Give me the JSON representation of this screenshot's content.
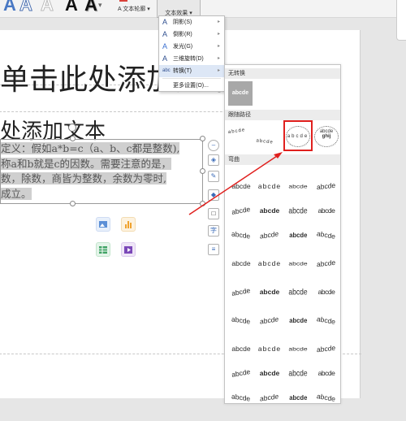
{
  "ribbon": {
    "art_letters": [
      "A",
      "A",
      "A",
      "A",
      "A"
    ],
    "art_dropdown_icon": "chevron-down-icon",
    "text_outline_label": "文本轮廓",
    "text_effects_label": "文本效果"
  },
  "slide": {
    "title": "单击此处添加文本",
    "subtitle": "处添加文本",
    "paragraph": [
      "定义：假如a*b=c（a、b、c都是整数),",
      "称a和b就是c的因数。需要注意的是，",
      "数，除数，商皆为整数，余数为零时,",
      "成立。"
    ]
  },
  "menu": {
    "items": [
      {
        "label": "阴影(S)",
        "icon": "shadow-icon"
      },
      {
        "label": "倒影(R)",
        "icon": "reflection-icon"
      },
      {
        "label": "发光(G)",
        "icon": "glow-icon"
      },
      {
        "label": "三维旋转(D)",
        "icon": "3d-rotate-icon"
      },
      {
        "label": "转换(T)",
        "icon": "transform-icon",
        "highlighted": true
      },
      {
        "label": "更多设置(O)..."
      }
    ]
  },
  "panel": {
    "no_transform_header": "无转换",
    "no_transform_sample": "abcde",
    "follow_path_header": "跟随路径",
    "warp_header": "弯曲",
    "sample_text": "abcde",
    "path_samples": [
      "abcde",
      "abcde",
      "abcde",
      "abcde"
    ],
    "path_extra": "ghij"
  },
  "colors": {
    "accent_red": "#e0201e",
    "menu_highlight": "#dde7f6"
  }
}
